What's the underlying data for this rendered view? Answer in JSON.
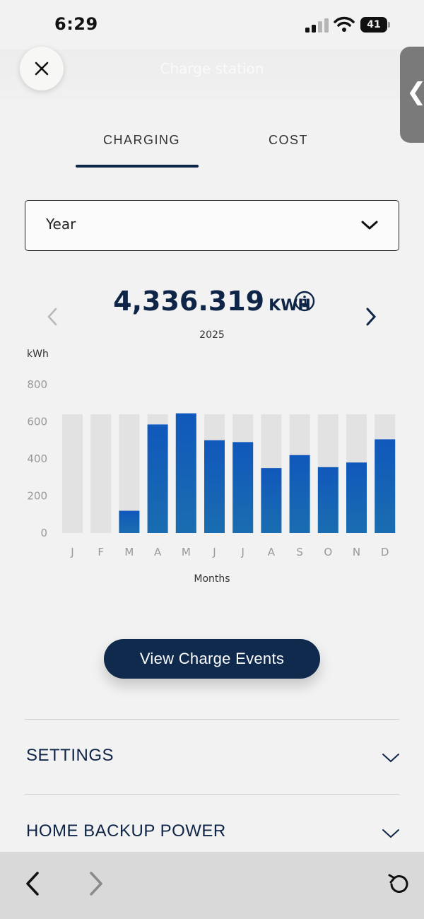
{
  "status_bar": {
    "time": "6:29",
    "battery": "41"
  },
  "header": {
    "title": "Charge station"
  },
  "tabs": [
    {
      "label": "CHARGING",
      "active": true
    },
    {
      "label": "COST",
      "active": false
    }
  ],
  "period_select": {
    "value": "Year"
  },
  "summary": {
    "total": "4,336.319",
    "unit": "KWH",
    "year": "2025"
  },
  "chart_data": {
    "type": "bar",
    "ylabel": "kWh",
    "xlabel": "Months",
    "categories": [
      "J",
      "F",
      "M",
      "A",
      "M",
      "J",
      "J",
      "A",
      "S",
      "O",
      "N",
      "D"
    ],
    "y_ticks": [
      "800",
      "600",
      "400",
      "200",
      "0"
    ],
    "ylim": [
      0,
      800
    ],
    "values": [
      0,
      0,
      120,
      585,
      645,
      500,
      490,
      350,
      420,
      355,
      380,
      505
    ],
    "background_max": 640,
    "colors": {
      "bar": "#1055b5",
      "background": "#e2e2e2"
    }
  },
  "actions": {
    "view_events": "View Charge Events"
  },
  "sections": [
    {
      "label": "SETTINGS"
    },
    {
      "label": "HOME BACKUP POWER"
    }
  ],
  "colors": {
    "navy": "#0e2547",
    "accent": "#1055b5"
  }
}
